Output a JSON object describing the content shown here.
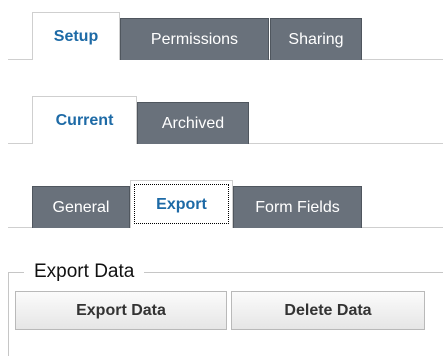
{
  "main_tabs": [
    {
      "label": "Setup",
      "active": true
    },
    {
      "label": "Permissions",
      "active": false
    },
    {
      "label": "Sharing",
      "active": false
    }
  ],
  "status_tabs": [
    {
      "label": "Current",
      "active": true
    },
    {
      "label": "Archived",
      "active": false
    }
  ],
  "section_tabs": [
    {
      "label": "General",
      "active": false
    },
    {
      "label": "Export",
      "active": true,
      "focused": true
    },
    {
      "label": "Form Fields",
      "active": false
    }
  ],
  "export_panel": {
    "legend": "Export Data",
    "export_button": "Export Data",
    "delete_button": "Delete Data"
  },
  "colors": {
    "active_tab_text": "#1d6aa6",
    "inactive_tab_bg": "#69717b",
    "inactive_tab_text": "#ffffff"
  }
}
